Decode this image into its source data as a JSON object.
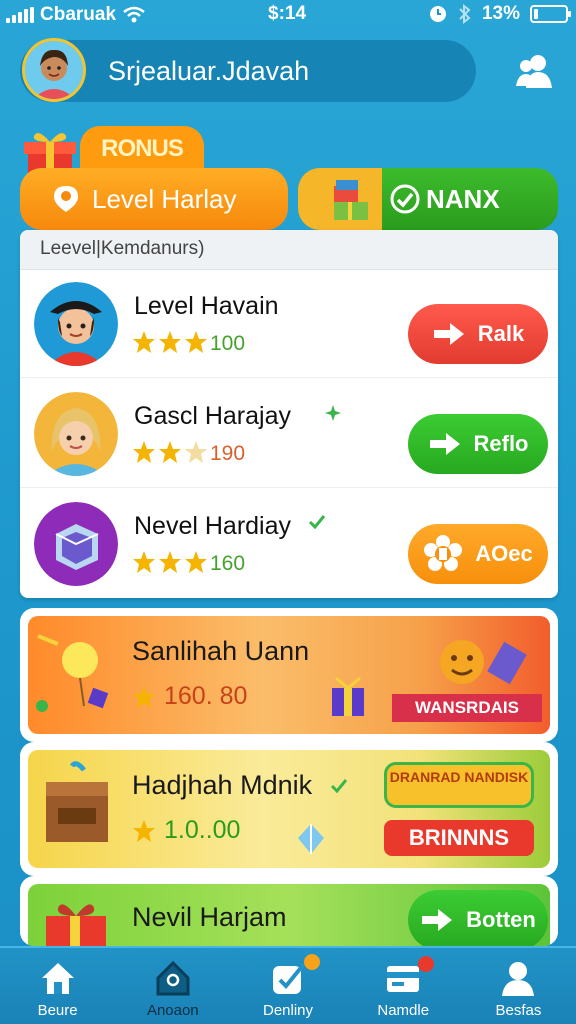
{
  "status_bar": {
    "carrier": "Cbaruak",
    "time": "$:14",
    "battery_percent": "13%",
    "battery_level": 0.13
  },
  "header": {
    "player_name": "Srjealuar.Jdavah"
  },
  "bonus": {
    "badge_label": "RONUS"
  },
  "tabs": [
    {
      "label": "Level Harlay"
    },
    {
      "label": "NANX"
    }
  ],
  "list": {
    "header": "Leevel|Kemdanurs)",
    "rows": [
      {
        "title": "Level Havain",
        "stars": 3,
        "score": "100",
        "button": "Ralk",
        "button_color": "#e84236"
      },
      {
        "title": "Gascl Harajay",
        "stars": 2,
        "score": "190",
        "button": "Reflo",
        "button_color": "#2fb126"
      },
      {
        "title": "Nevel Hardiay",
        "stars": 3,
        "score": "160",
        "button": "AOec",
        "button_color": "#f99a14"
      }
    ]
  },
  "events": [
    {
      "title": "Sanlihah Uann",
      "score": "160. 80",
      "banner": "WANSRDAIS"
    },
    {
      "title": "Hadjhah Mdnik",
      "score": "1.0..00",
      "badge": "DRANRAD NANDISK",
      "banner": "BRINNNS"
    },
    {
      "title": "Nevil Harjam",
      "button": "Botten"
    }
  ],
  "bottom_nav": [
    {
      "label": "Beure"
    },
    {
      "label": "Anoaon"
    },
    {
      "label": "Denliny"
    },
    {
      "label": "Namdle"
    },
    {
      "label": "Besfas"
    }
  ],
  "colors": {
    "background": "#1d97cc",
    "red_button": "#e84236",
    "green_button": "#2fb126",
    "orange_button": "#f99a14"
  }
}
